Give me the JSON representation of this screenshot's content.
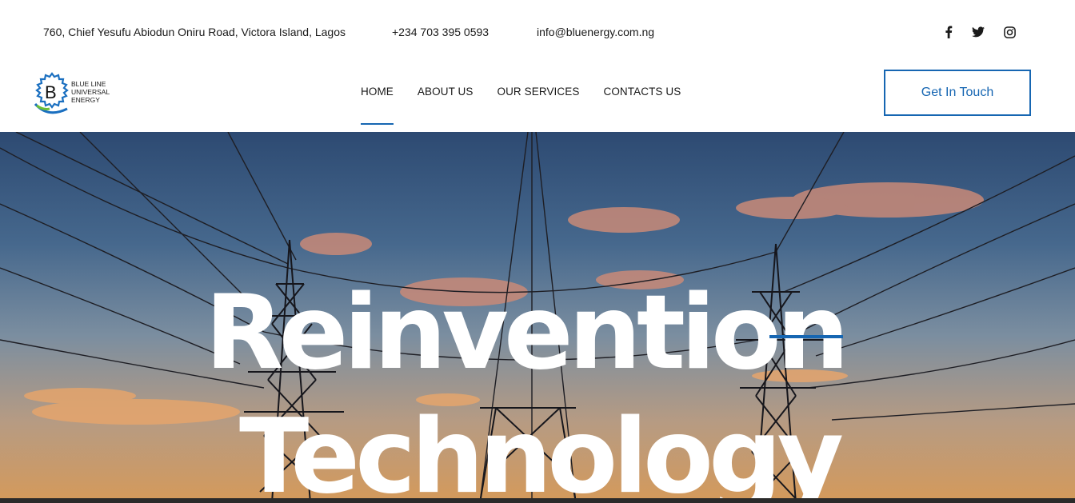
{
  "topbar": {
    "address": "760, Chief Yesufu Abiodun Oniru Road, Victora Island, Lagos",
    "phone": "+234 703 395 0593",
    "email": "info@bluenergy.com.ng",
    "social": [
      "facebook-icon",
      "twitter-icon",
      "instagram-icon"
    ]
  },
  "logo": {
    "letter": "B",
    "text": "BLUE LINE\nUNIVERSAL\nENERGY"
  },
  "nav": {
    "items": [
      {
        "label": "HOME",
        "active": true
      },
      {
        "label": "ABOUT US",
        "active": false
      },
      {
        "label": "OUR SERVICES",
        "active": false
      },
      {
        "label": "CONTACTS US",
        "active": false
      }
    ],
    "cta_label": "Get In Touch"
  },
  "hero": {
    "line1": "Reinvention",
    "line2": "Technology"
  },
  "colors": {
    "accent": "#1666b2",
    "text": "#1a1a1a"
  }
}
